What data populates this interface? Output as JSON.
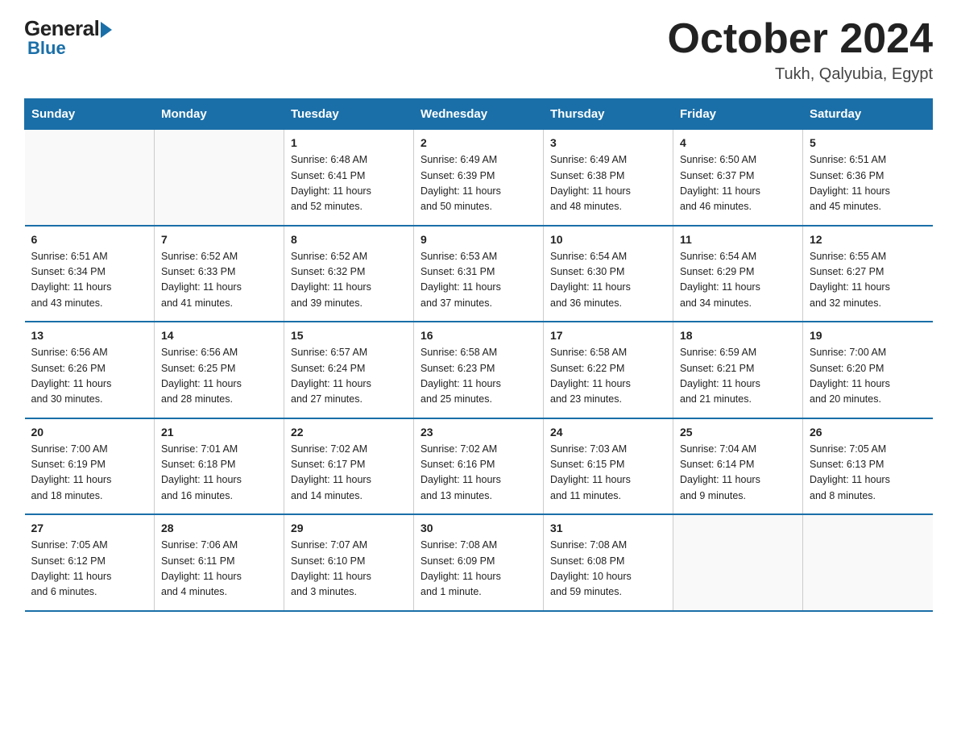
{
  "header": {
    "logo_general": "General",
    "logo_blue": "Blue",
    "month_title": "October 2024",
    "location": "Tukh, Qalyubia, Egypt"
  },
  "weekdays": [
    "Sunday",
    "Monday",
    "Tuesday",
    "Wednesday",
    "Thursday",
    "Friday",
    "Saturday"
  ],
  "weeks": [
    [
      {
        "day": "",
        "info": ""
      },
      {
        "day": "",
        "info": ""
      },
      {
        "day": "1",
        "info": "Sunrise: 6:48 AM\nSunset: 6:41 PM\nDaylight: 11 hours\nand 52 minutes."
      },
      {
        "day": "2",
        "info": "Sunrise: 6:49 AM\nSunset: 6:39 PM\nDaylight: 11 hours\nand 50 minutes."
      },
      {
        "day": "3",
        "info": "Sunrise: 6:49 AM\nSunset: 6:38 PM\nDaylight: 11 hours\nand 48 minutes."
      },
      {
        "day": "4",
        "info": "Sunrise: 6:50 AM\nSunset: 6:37 PM\nDaylight: 11 hours\nand 46 minutes."
      },
      {
        "day": "5",
        "info": "Sunrise: 6:51 AM\nSunset: 6:36 PM\nDaylight: 11 hours\nand 45 minutes."
      }
    ],
    [
      {
        "day": "6",
        "info": "Sunrise: 6:51 AM\nSunset: 6:34 PM\nDaylight: 11 hours\nand 43 minutes."
      },
      {
        "day": "7",
        "info": "Sunrise: 6:52 AM\nSunset: 6:33 PM\nDaylight: 11 hours\nand 41 minutes."
      },
      {
        "day": "8",
        "info": "Sunrise: 6:52 AM\nSunset: 6:32 PM\nDaylight: 11 hours\nand 39 minutes."
      },
      {
        "day": "9",
        "info": "Sunrise: 6:53 AM\nSunset: 6:31 PM\nDaylight: 11 hours\nand 37 minutes."
      },
      {
        "day": "10",
        "info": "Sunrise: 6:54 AM\nSunset: 6:30 PM\nDaylight: 11 hours\nand 36 minutes."
      },
      {
        "day": "11",
        "info": "Sunrise: 6:54 AM\nSunset: 6:29 PM\nDaylight: 11 hours\nand 34 minutes."
      },
      {
        "day": "12",
        "info": "Sunrise: 6:55 AM\nSunset: 6:27 PM\nDaylight: 11 hours\nand 32 minutes."
      }
    ],
    [
      {
        "day": "13",
        "info": "Sunrise: 6:56 AM\nSunset: 6:26 PM\nDaylight: 11 hours\nand 30 minutes."
      },
      {
        "day": "14",
        "info": "Sunrise: 6:56 AM\nSunset: 6:25 PM\nDaylight: 11 hours\nand 28 minutes."
      },
      {
        "day": "15",
        "info": "Sunrise: 6:57 AM\nSunset: 6:24 PM\nDaylight: 11 hours\nand 27 minutes."
      },
      {
        "day": "16",
        "info": "Sunrise: 6:58 AM\nSunset: 6:23 PM\nDaylight: 11 hours\nand 25 minutes."
      },
      {
        "day": "17",
        "info": "Sunrise: 6:58 AM\nSunset: 6:22 PM\nDaylight: 11 hours\nand 23 minutes."
      },
      {
        "day": "18",
        "info": "Sunrise: 6:59 AM\nSunset: 6:21 PM\nDaylight: 11 hours\nand 21 minutes."
      },
      {
        "day": "19",
        "info": "Sunrise: 7:00 AM\nSunset: 6:20 PM\nDaylight: 11 hours\nand 20 minutes."
      }
    ],
    [
      {
        "day": "20",
        "info": "Sunrise: 7:00 AM\nSunset: 6:19 PM\nDaylight: 11 hours\nand 18 minutes."
      },
      {
        "day": "21",
        "info": "Sunrise: 7:01 AM\nSunset: 6:18 PM\nDaylight: 11 hours\nand 16 minutes."
      },
      {
        "day": "22",
        "info": "Sunrise: 7:02 AM\nSunset: 6:17 PM\nDaylight: 11 hours\nand 14 minutes."
      },
      {
        "day": "23",
        "info": "Sunrise: 7:02 AM\nSunset: 6:16 PM\nDaylight: 11 hours\nand 13 minutes."
      },
      {
        "day": "24",
        "info": "Sunrise: 7:03 AM\nSunset: 6:15 PM\nDaylight: 11 hours\nand 11 minutes."
      },
      {
        "day": "25",
        "info": "Sunrise: 7:04 AM\nSunset: 6:14 PM\nDaylight: 11 hours\nand 9 minutes."
      },
      {
        "day": "26",
        "info": "Sunrise: 7:05 AM\nSunset: 6:13 PM\nDaylight: 11 hours\nand 8 minutes."
      }
    ],
    [
      {
        "day": "27",
        "info": "Sunrise: 7:05 AM\nSunset: 6:12 PM\nDaylight: 11 hours\nand 6 minutes."
      },
      {
        "day": "28",
        "info": "Sunrise: 7:06 AM\nSunset: 6:11 PM\nDaylight: 11 hours\nand 4 minutes."
      },
      {
        "day": "29",
        "info": "Sunrise: 7:07 AM\nSunset: 6:10 PM\nDaylight: 11 hours\nand 3 minutes."
      },
      {
        "day": "30",
        "info": "Sunrise: 7:08 AM\nSunset: 6:09 PM\nDaylight: 11 hours\nand 1 minute."
      },
      {
        "day": "31",
        "info": "Sunrise: 7:08 AM\nSunset: 6:08 PM\nDaylight: 10 hours\nand 59 minutes."
      },
      {
        "day": "",
        "info": ""
      },
      {
        "day": "",
        "info": ""
      }
    ]
  ]
}
